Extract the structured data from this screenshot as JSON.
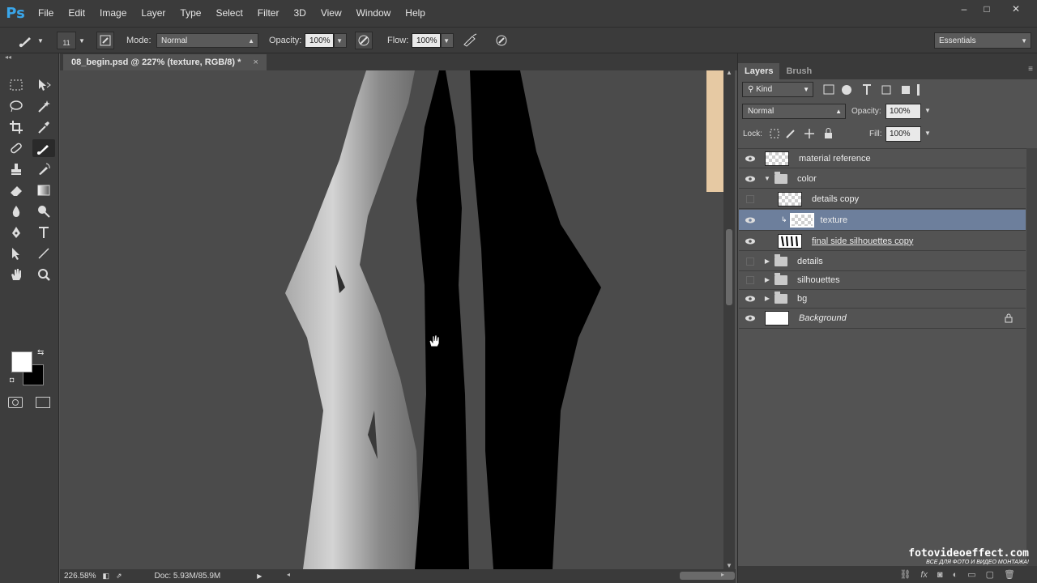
{
  "app": {
    "logo": "Ps"
  },
  "menu": [
    "File",
    "Edit",
    "Image",
    "Layer",
    "Type",
    "Select",
    "Filter",
    "3D",
    "View",
    "Window",
    "Help"
  ],
  "window_controls": {
    "minimize": "–",
    "maximize": "□",
    "close": "✕"
  },
  "options": {
    "brush_size": "11",
    "mode_label": "Mode:",
    "mode_value": "Normal",
    "opacity_label": "Opacity:",
    "opacity_value": "100%",
    "flow_label": "Flow:",
    "flow_value": "100%",
    "workspace": "Essentials"
  },
  "document": {
    "tab_title": "08_begin.psd @ 227% (texture, RGB/8) *",
    "close": "×",
    "zoom": "226.58%",
    "doc_info": "Doc: 5.93M/85.9M"
  },
  "panel": {
    "tabs": [
      "Layers",
      "Brush"
    ],
    "filter_kind": "Kind",
    "blend_mode": "Normal",
    "opacity_label": "Opacity:",
    "opacity_value": "100%",
    "lock_label": "Lock:",
    "fill_label": "Fill:",
    "fill_value": "100%"
  },
  "layers": [
    {
      "name": "material reference",
      "visible": true,
      "type": "layer"
    },
    {
      "name": "color",
      "visible": true,
      "type": "group-open"
    },
    {
      "name": "details copy",
      "visible": false,
      "type": "layer",
      "indent": true
    },
    {
      "name": "texture",
      "visible": true,
      "type": "layer",
      "indent": true,
      "selected": true,
      "clipped": true
    },
    {
      "name": "final side silhouettes copy",
      "visible": true,
      "type": "layer",
      "indent": true
    },
    {
      "name": "details",
      "visible": false,
      "type": "group"
    },
    {
      "name": "silhouettes",
      "visible": false,
      "type": "group"
    },
    {
      "name": "bg",
      "visible": true,
      "type": "group"
    },
    {
      "name": "Background",
      "visible": true,
      "type": "background",
      "locked": true
    }
  ],
  "watermark": {
    "main": "fotovideoeffect.com",
    "sub": "ВСЕ ДЛЯ ФОТО И ВИДЕО МОНТАЖА!"
  }
}
